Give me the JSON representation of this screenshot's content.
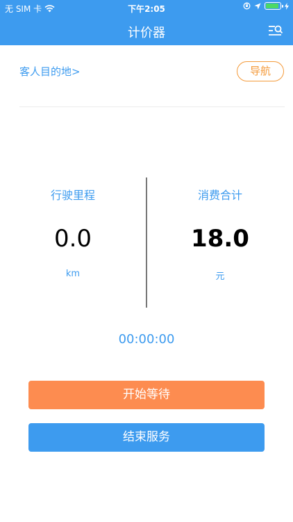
{
  "status_bar": {
    "carrier": "无 SIM 卡",
    "time": "下午2:05",
    "battery_color": "#4cd964"
  },
  "header": {
    "title": "计价器",
    "menu_icon": "menu-search-icon",
    "background": "#3d9bef"
  },
  "destination": {
    "label": "客人目的地",
    "chevron": ">",
    "nav_button": "导航"
  },
  "stats": {
    "distance": {
      "label": "行驶里程",
      "value": "0.0",
      "unit": "km"
    },
    "fare": {
      "label": "消费合计",
      "value": "18.0",
      "unit": "元"
    }
  },
  "timer": "00:00:00",
  "buttons": {
    "wait": "开始等待",
    "end": "结束服务",
    "wait_color": "#fd8c50",
    "end_color": "#3d9bef"
  }
}
